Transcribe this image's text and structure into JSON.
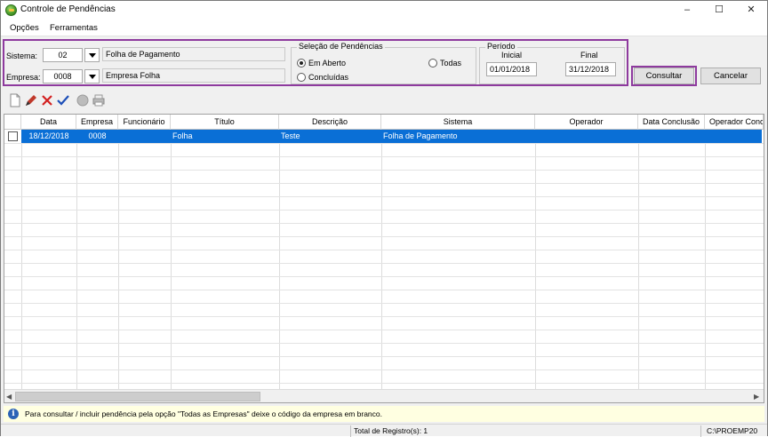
{
  "window": {
    "title": "Controle de Pendências"
  },
  "menu": [
    {
      "label": "Opções"
    },
    {
      "label": "Ferramentas"
    }
  ],
  "filters": {
    "sistema_label": "Sistema:",
    "sistema_code": "02",
    "sistema_name": "Folha de Pagamento",
    "empresa_label": "Empresa:",
    "empresa_code": "0008",
    "empresa_name": "Empresa Folha",
    "selecao": {
      "title": "Seleção de Pendências",
      "options": [
        "Em Aberto",
        "Todas",
        "Concluídas"
      ],
      "selected": "Em Aberto"
    },
    "periodo": {
      "title": "Período",
      "inicial_label": "Inicial",
      "inicial": "01/01/2018",
      "final_label": "Final",
      "final": "31/12/2018"
    }
  },
  "buttons": {
    "consultar": "Consultar",
    "cancelar": "Cancelar"
  },
  "toolbar": [
    "new-icon",
    "edit-icon",
    "delete-icon",
    "confirm-icon",
    "globe-icon",
    "print-icon"
  ],
  "grid": {
    "columns": [
      "Data",
      "Empresa",
      "Funcionário",
      "Título",
      "Descrição",
      "Sistema",
      "Operador",
      "Data Conclusão",
      "Operador Conc"
    ],
    "rows": [
      {
        "data": "18/12/2018",
        "empresa": "0008",
        "funcionario": "",
        "titulo": "Folha",
        "descricao": "Teste",
        "sistema": "Folha de Pagamento",
        "operador": "",
        "data_conclusao": "",
        "operador_conc": ""
      }
    ]
  },
  "info": {
    "text": "Para consultar / incluir pendência pela opção \"Todas as Empresas\" deixe o código da empresa em branco."
  },
  "status": {
    "total": "Total de Registro(s): 1",
    "path": "C:\\PROEMP20"
  },
  "colors": {
    "selection": "#0a6fd6",
    "highlight_border": "#8e3a9e",
    "info_bg": "#ffffe1"
  }
}
